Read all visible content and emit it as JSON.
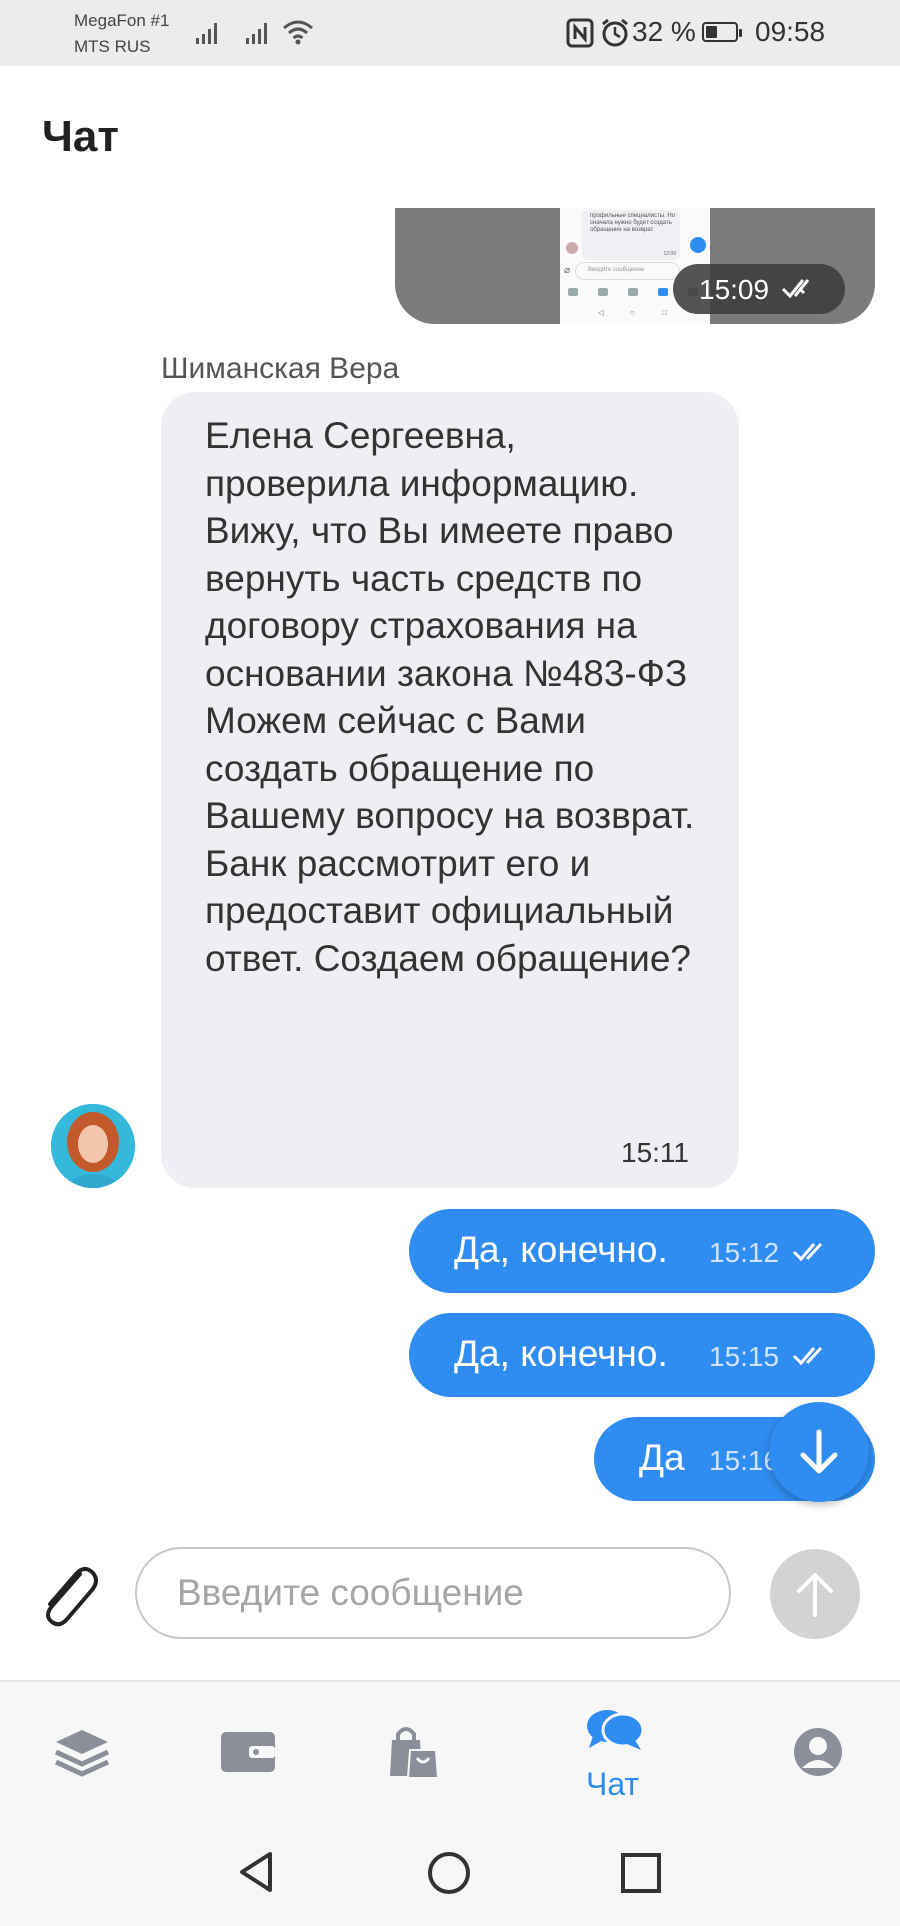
{
  "status_bar": {
    "carrier1": "MegaFon #1",
    "carrier2": "MTS RUS",
    "battery_percent": "32 %",
    "time": "09:58"
  },
  "header": {
    "title": "Чат"
  },
  "messages": {
    "image_message": {
      "time": "15:09",
      "preview_text": "профильные специалисты. Но сначала нужно будет создать обращение на возврат",
      "preview_time": "12:09",
      "preview_input_placeholder": "Введите сообщение",
      "preview_nav_label": "Чат"
    },
    "incoming": {
      "sender": "Шиманская Вера",
      "text": "Елена Сергеевна, проверила информацию. Вижу, что Вы имеете право вернуть часть средств по договору страхования на основании закона №483-ФЗ Можем сейчас с Вами создать обращение по Вашему вопросу на возврат. Банк рассмотрит его и предоставит официальный ответ. Создаем обращение?",
      "time": "15:11"
    },
    "outgoing": [
      {
        "text": "Да, конечно.",
        "time": "15:12"
      },
      {
        "text": "Да, конечно.",
        "time": "15:15"
      },
      {
        "text": "Да",
        "time": "15:16"
      }
    ]
  },
  "composer": {
    "placeholder": "Введите сообщение"
  },
  "bottom_nav": {
    "active_label": "Чат"
  },
  "colors": {
    "accent": "#2f8cf0",
    "incoming_bubble": "#eeeff3",
    "send_disabled": "#d3d3d3"
  }
}
